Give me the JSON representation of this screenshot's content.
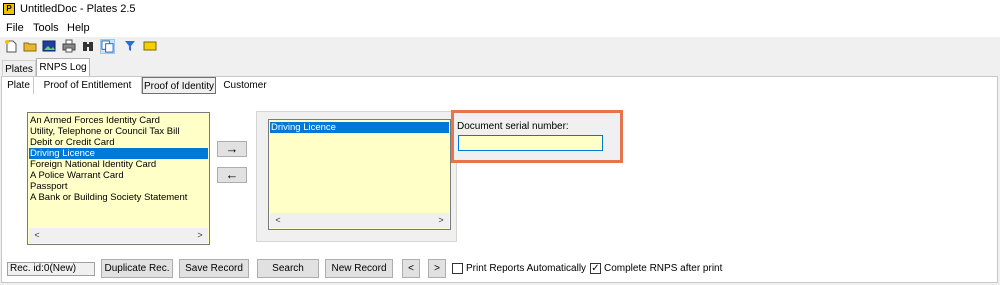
{
  "window": {
    "title": "UntitledDoc - Plates 2.5",
    "icon": "P"
  },
  "menu": [
    "File",
    "Tools",
    "Help"
  ],
  "toolbar": {
    "icons": [
      "new-doc-icon",
      "open-folder-icon",
      "image-icon",
      "print-icon",
      "binoculars-icon",
      "copy-icon",
      "filter-icon",
      "label-icon"
    ]
  },
  "main_tabs": [
    {
      "label": "Plates"
    },
    {
      "label": "RNPS Log"
    }
  ],
  "sub_tabs": [
    {
      "label": "Plate"
    },
    {
      "label": "Proof of Entitlement"
    },
    {
      "label": "Proof of Identity"
    },
    {
      "label": "Customer"
    }
  ],
  "available_list": {
    "items": [
      "An Armed Forces Identity Card",
      "Utility, Telephone or Council Tax Bill",
      "Debit or Credit Card",
      "Driving Licence",
      "Foreign National Identity Card",
      "A Police Warrant Card",
      "Passport",
      "A Bank or Building Society Statement"
    ],
    "selected": "Driving Licence"
  },
  "move_buttons": {
    "add": "→",
    "remove": "←"
  },
  "selected_list": {
    "items": [
      "Driving Licence"
    ],
    "selected": "Driving Licence"
  },
  "scroll": {
    "left": "<",
    "right": ">"
  },
  "serial": {
    "label": "Document serial number:",
    "value": ""
  },
  "footer": {
    "record_id": "Rec. id:0(New)",
    "duplicate": "Duplicate Rec.",
    "save": "Save Record",
    "search": "Search",
    "new_record": "New Record",
    "prev": "<",
    "next": ">",
    "print_auto_label": "Print Reports Automatically",
    "print_auto_checked": false,
    "complete_label": "Complete RNPS after print",
    "complete_checked": true
  },
  "colors": {
    "list_bg": "#ffffc8",
    "selection": "#0078d7",
    "highlight_border": "#e8744f"
  }
}
